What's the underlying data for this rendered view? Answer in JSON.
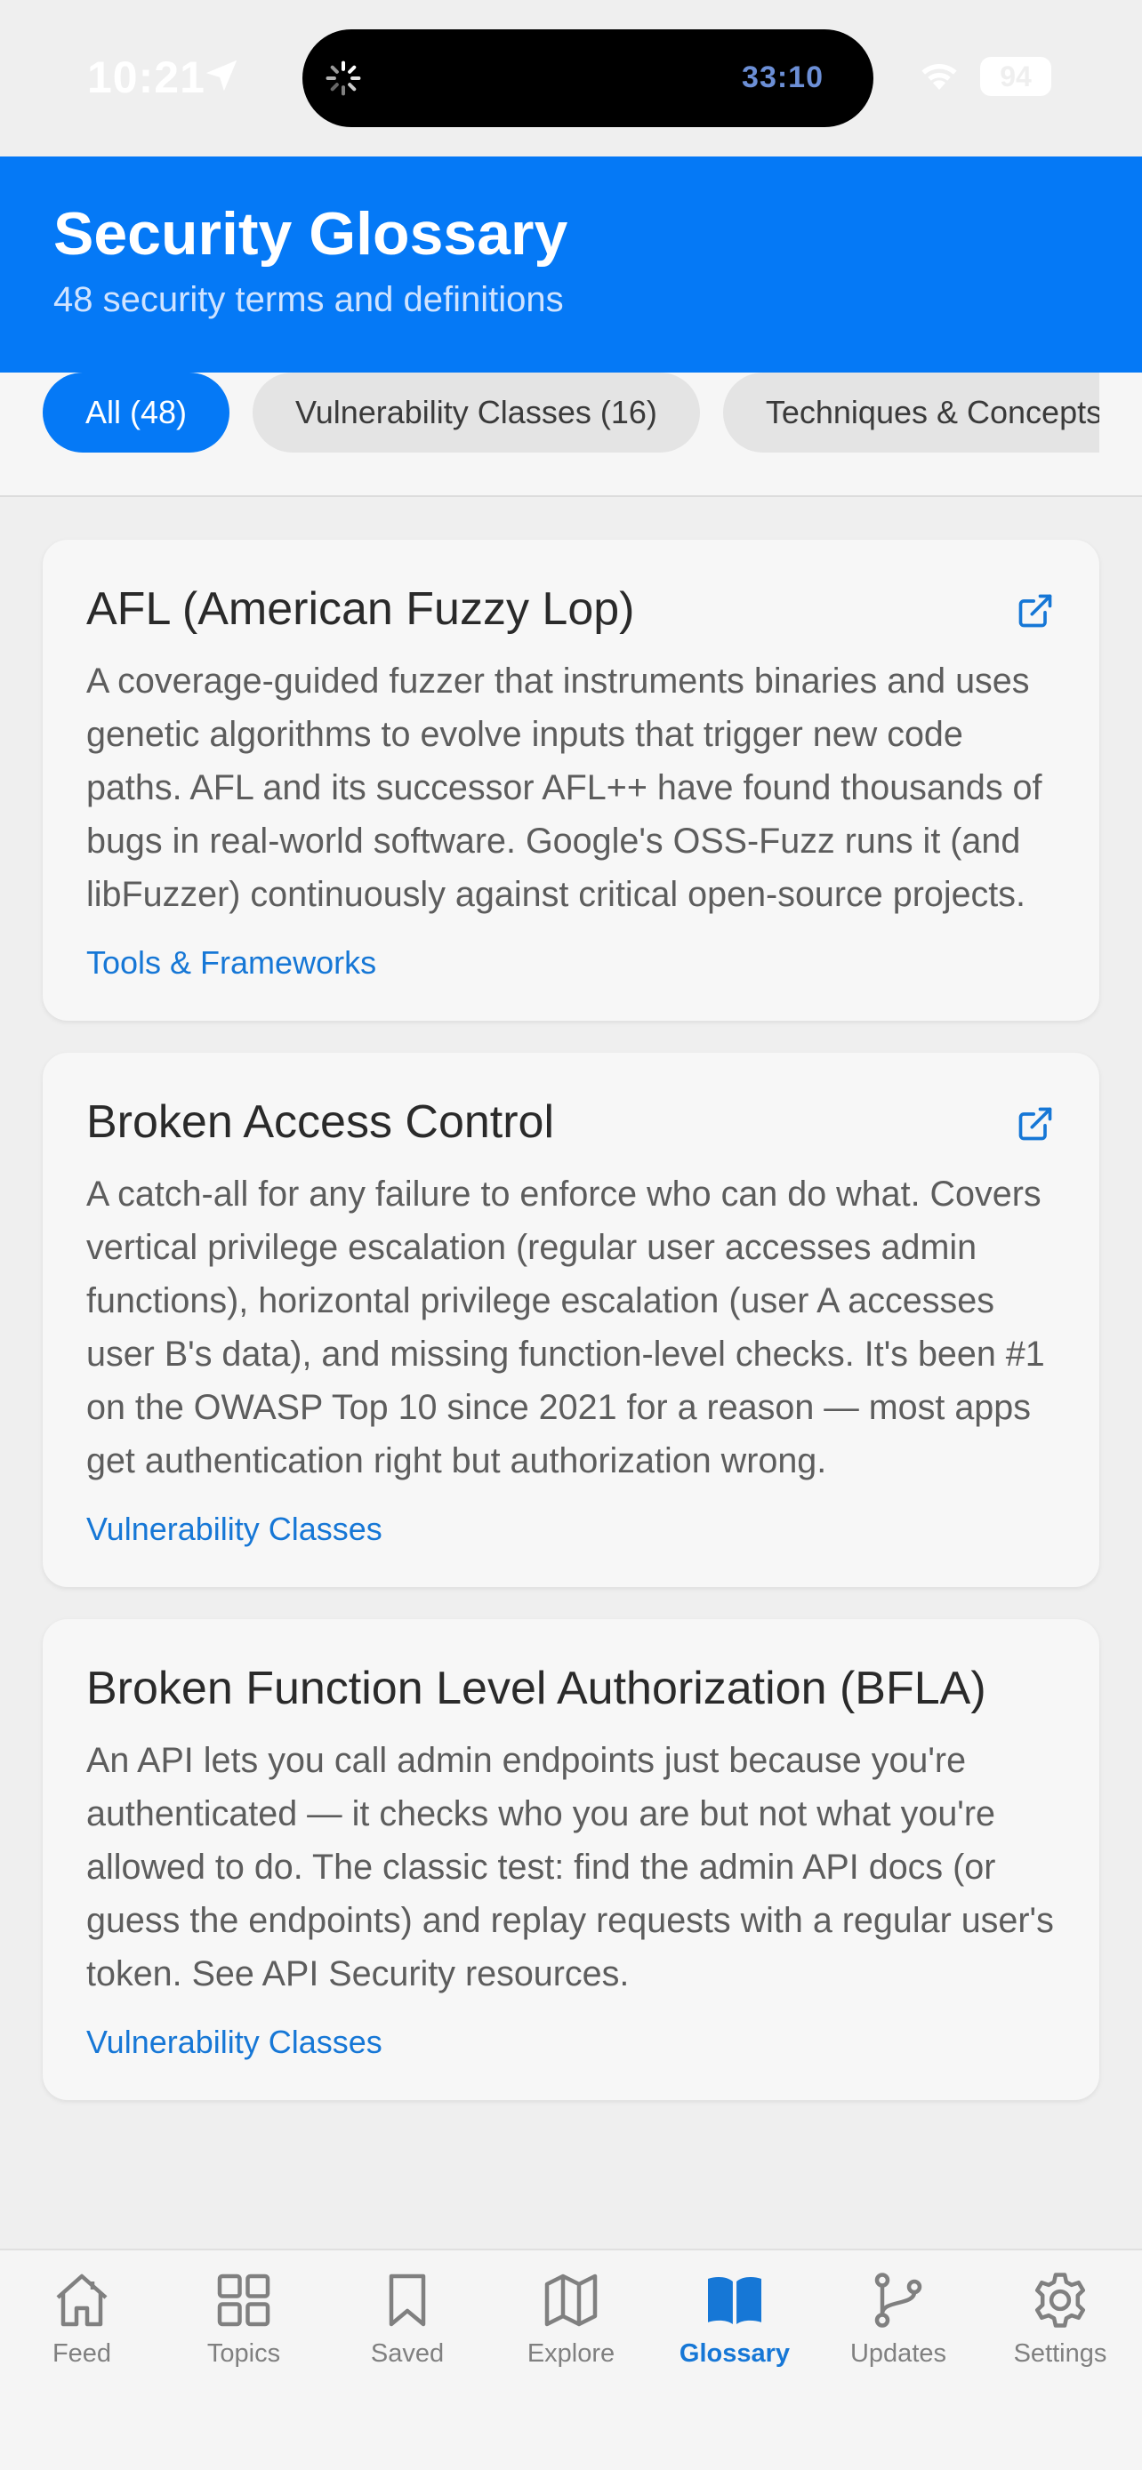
{
  "status_bar": {
    "time": "10:21",
    "timer": "33:10",
    "battery": "94"
  },
  "header": {
    "title": "Security Glossary",
    "subtitle": "48 security terms and definitions"
  },
  "filters": [
    {
      "label": "All (48)",
      "active": true
    },
    {
      "label": "Vulnerability Classes (16)",
      "active": false
    },
    {
      "label": "Techniques & Concepts",
      "active": false
    }
  ],
  "terms": [
    {
      "title": "AFL (American Fuzzy Lop)",
      "description": "A coverage-guided fuzzer that instruments binaries and uses genetic algorithms to evolve inputs that trigger new code paths. AFL and its successor AFL++ have found thousands of bugs in real-world software. Google's OSS-Fuzz runs it (and libFuzzer) continuously against critical open-source projects.",
      "category": "Tools & Frameworks",
      "has_link": true
    },
    {
      "title": "Broken Access Control",
      "description": "A catch-all for any failure to enforce who can do what. Covers vertical privilege escalation (regular user accesses admin functions), horizontal privilege escalation (user A accesses user B's data), and missing function-level checks. It's been #1 on the OWASP Top 10 since 2021 for a reason — most apps get authentication right but authorization wrong.",
      "category": "Vulnerability Classes",
      "has_link": true
    },
    {
      "title": "Broken Function Level Authorization (BFLA)",
      "description": "An API lets you call admin endpoints just because you're authenticated — it checks who you are but not what you're allowed to do. The classic test: find the admin API docs (or guess the endpoints) and replay requests with a regular user's token. See API Security resources.",
      "category": "Vulnerability Classes",
      "has_link": false
    }
  ],
  "tabs": [
    {
      "label": "Feed",
      "icon": "house-icon",
      "active": false
    },
    {
      "label": "Topics",
      "icon": "grid-icon",
      "active": false
    },
    {
      "label": "Saved",
      "icon": "bookmark-icon",
      "active": false
    },
    {
      "label": "Explore",
      "icon": "map-icon",
      "active": false
    },
    {
      "label": "Glossary",
      "icon": "book-icon",
      "active": true
    },
    {
      "label": "Updates",
      "icon": "branch-icon",
      "active": false
    },
    {
      "label": "Settings",
      "icon": "gear-icon",
      "active": false
    }
  ],
  "colors": {
    "accent": "#0579f6",
    "link": "#1677d6",
    "inactive_tab": "#808080"
  }
}
